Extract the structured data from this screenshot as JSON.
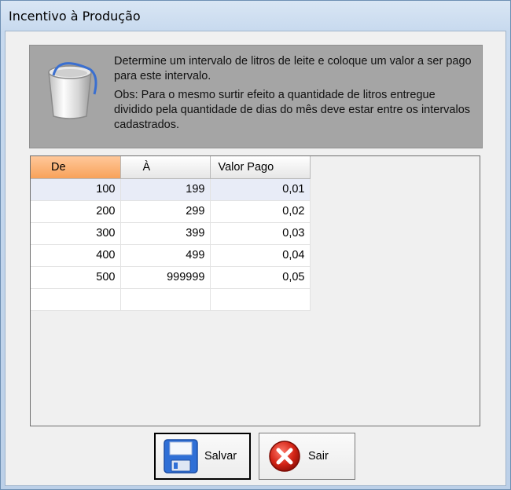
{
  "window": {
    "title": "Incentivo à Produção"
  },
  "info": {
    "paragraph1": "Determine um intervalo de litros de leite e coloque um valor a ser pago para este intervalo.",
    "paragraph2": "Obs: Para o mesmo surtir efeito a quantidade de litros entregue dividido pela quantidade de dias do mês deve estar entre os intervalos cadastrados.",
    "icon": "bucket-icon"
  },
  "grid": {
    "columns": [
      "De",
      "À",
      "Valor Pago"
    ],
    "rows": [
      [
        "100",
        "199",
        "0,01"
      ],
      [
        "200",
        "299",
        "0,02"
      ],
      [
        "300",
        "399",
        "0,03"
      ],
      [
        "400",
        "499",
        "0,04"
      ],
      [
        "500",
        "999999",
        "0,05"
      ],
      [
        "",
        "",
        ""
      ]
    ],
    "selected_column_color": "#f8a25a"
  },
  "buttons": {
    "save_label": "Salvar",
    "exit_label": "Sair",
    "save_icon": "floppy-disk-icon",
    "exit_icon": "close-x-icon"
  }
}
